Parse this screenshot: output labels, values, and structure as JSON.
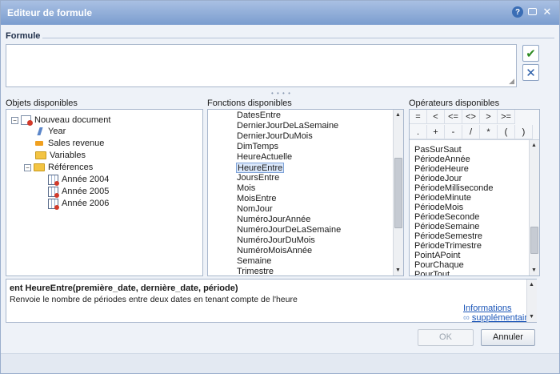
{
  "window": {
    "title": "Editeur de formule"
  },
  "formula": {
    "label": "Formule",
    "value": ""
  },
  "objects": {
    "label": "Objets disponibles",
    "root": "Nouveau document",
    "items": [
      "Year",
      "Sales revenue",
      "Variables",
      "Références"
    ],
    "references": [
      "Année 2004",
      "Année 2005",
      "Année 2006"
    ]
  },
  "functions": {
    "label": "Fonctions disponibles",
    "items": [
      "DatesEntre",
      "DernierJourDeLaSemaine",
      "DernierJourDuMois",
      "DimTemps",
      "HeureActuelle",
      "HeureEntre",
      "JoursEntre",
      "Mois",
      "MoisEntre",
      "NomJour",
      "NuméroJourAnnée",
      "NuméroJourDeLaSemaine",
      "NuméroJourDuMois",
      "NuméroMoisAnnée",
      "Semaine",
      "Trimestre"
    ],
    "selected": "HeureEntre"
  },
  "operators": {
    "label": "Opérateurs disponibles",
    "symbols": [
      "=",
      "<",
      "<=",
      "<>",
      ">",
      ">=",
      ".",
      "+",
      "-",
      "/",
      "*",
      "(",
      ")"
    ],
    "items": [
      "PasSurSaut",
      "PériodeAnnée",
      "PériodeHeure",
      "PériodeJour",
      "PériodeMilliseconde",
      "PériodeMinute",
      "PériodeMois",
      "PériodeSeconde",
      "PériodeSemaine",
      "PériodeSemestre",
      "PériodeTrimestre",
      "PointAPoint",
      "PourChaque",
      "PourTout"
    ]
  },
  "description": {
    "signature": "ent HeureEntre(première_date, dernière_date, période)",
    "text": "Renvoie le nombre de périodes entre deux dates en tenant compte de l'heure",
    "link1": "Informations",
    "link2": "supplémentaires"
  },
  "buttons": {
    "ok": "OK",
    "cancel": "Annuler"
  },
  "icons": [
    "help-icon",
    "restore-icon",
    "close-icon",
    "check-icon",
    "clear-icon",
    "document-icon",
    "dimension-icon",
    "measure-icon",
    "folder-icon",
    "table-icon"
  ]
}
